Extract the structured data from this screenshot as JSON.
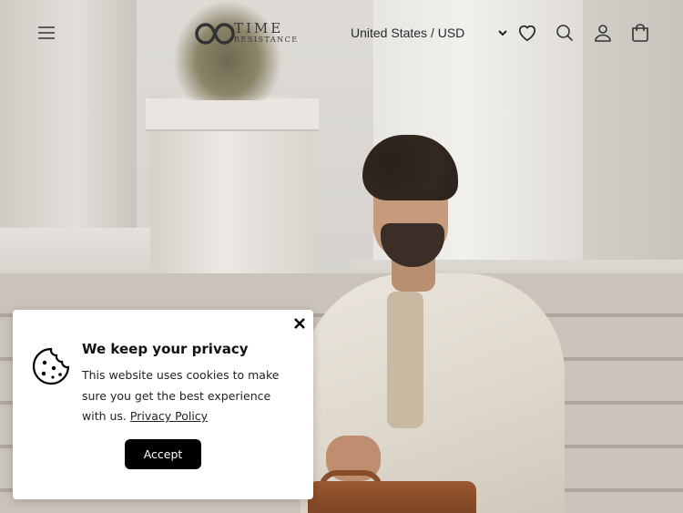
{
  "header": {
    "logo_main": "TIME",
    "logo_sub": "RESISTANCE",
    "country_selector": "United States / USD"
  },
  "icons": {
    "menu": "hamburger-menu-icon",
    "wishlist": "heart-icon",
    "search": "search-icon",
    "account": "user-icon",
    "cart": "shopping-bag-icon",
    "country_dropdown": "chevron-down-icon",
    "cookie": "cookie-icon",
    "close": "close-icon"
  },
  "cookie_popup": {
    "title": "We keep your privacy",
    "body": "This website uses cookies to make sure you get the best experience with us.",
    "link_label": "Privacy Policy",
    "accept_label": "Accept"
  },
  "colors": {
    "text_dark": "#2a2a2a",
    "button_bg": "#000000",
    "button_text": "#ffffff",
    "popup_bg": "#ffffff"
  }
}
